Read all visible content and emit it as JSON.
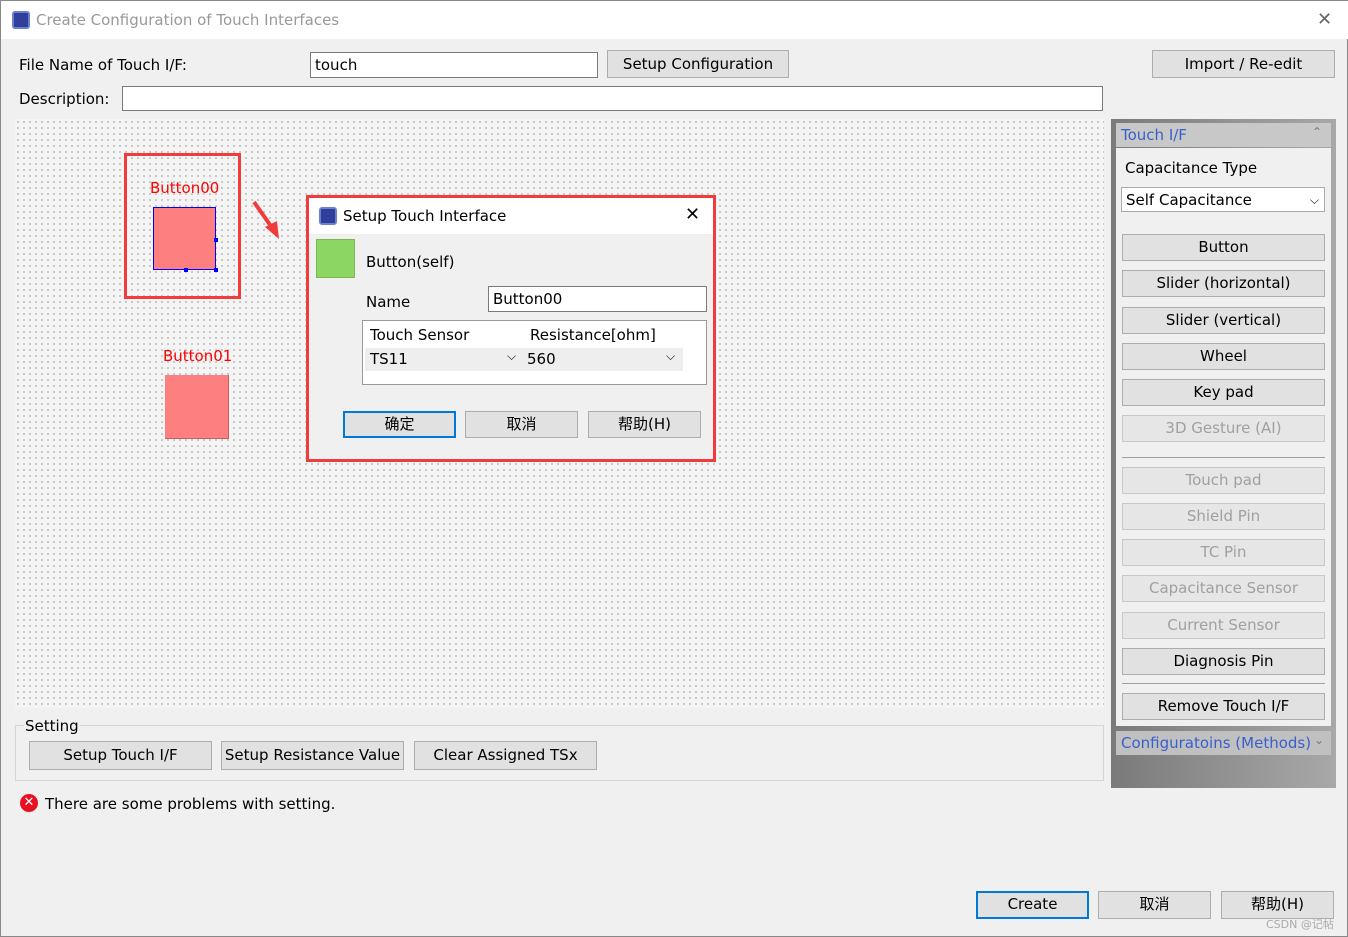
{
  "window": {
    "title": "Create Configuration of Touch Interfaces",
    "close": "✕"
  },
  "form": {
    "file_label": "File Name of Touch I/F:",
    "file_value": "touch",
    "setup_config": "Setup Configuration",
    "import": "Import / Re-edit",
    "desc_label": "Description:",
    "desc_value": ""
  },
  "canvas": {
    "buttons": [
      {
        "label": "Button00"
      },
      {
        "label": "Button01"
      }
    ]
  },
  "dialog": {
    "title": "Setup Touch Interface",
    "close": "✕",
    "type": "Button(self)",
    "name_label": "Name",
    "name_value": "Button00",
    "col1": "Touch Sensor",
    "col2": "Resistance[ohm]",
    "sensor": "TS11",
    "resistance": "560",
    "ok": "确定",
    "cancel": "取消",
    "help": "帮助(H)",
    "color": "#8cd663"
  },
  "panel": {
    "header": "Touch I/F",
    "cap_label": "Capacitance Type",
    "cap_value": "Self Capacitance",
    "items": [
      {
        "label": "Button",
        "enabled": true
      },
      {
        "label": "Slider (horizontal)",
        "enabled": true
      },
      {
        "label": "Slider (vertical)",
        "enabled": true
      },
      {
        "label": "Wheel",
        "enabled": true
      },
      {
        "label": "Key pad",
        "enabled": true
      },
      {
        "label": "3D Gesture (AI)",
        "enabled": false
      },
      {
        "label": "Touch pad",
        "enabled": false
      },
      {
        "label": "Shield Pin",
        "enabled": false
      },
      {
        "label": "TC Pin",
        "enabled": false
      },
      {
        "label": "Capacitance Sensor",
        "enabled": false
      },
      {
        "label": "Current Sensor",
        "enabled": false
      },
      {
        "label": "Diagnosis Pin",
        "enabled": true
      }
    ],
    "remove": "Remove Touch I/F",
    "methods": "Configuratoins (Methods)"
  },
  "setting": {
    "title": "Setting",
    "setup_touch": "Setup Touch I/F",
    "setup_res": "Setup Resistance Value",
    "clear": "Clear Assigned TSx"
  },
  "status": {
    "message": "There are some problems with setting."
  },
  "footer": {
    "create": "Create",
    "cancel": "取消",
    "help": "帮助(H)",
    "watermark": "CSDN @记帖"
  }
}
